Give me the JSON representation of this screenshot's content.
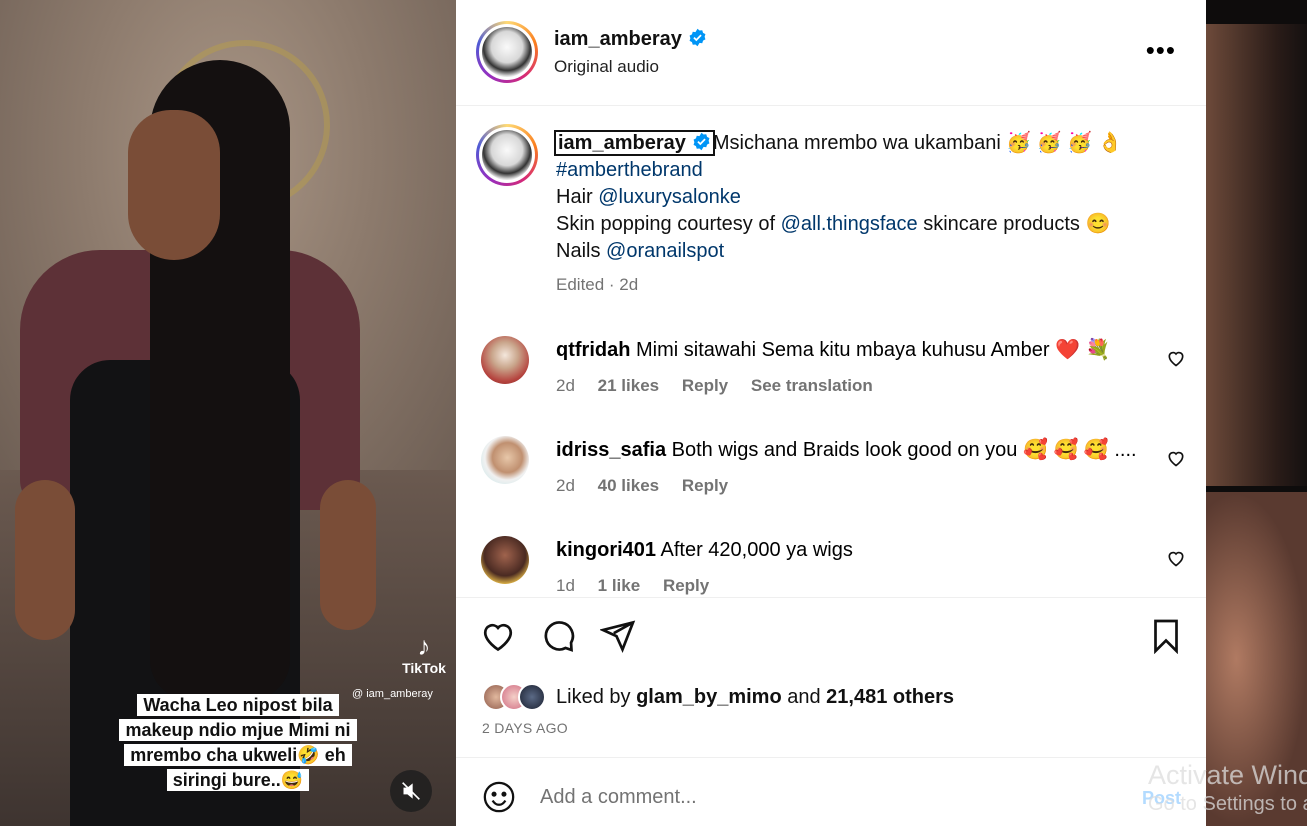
{
  "video": {
    "overlay_text": "Wacha Leo nipost bila makeup ndio mjue Mimi ni mrembo cha ukweli🤣 eh siringi bure..😅",
    "tiktok_label": "TikTok",
    "tiktok_handle": "@ iam_amberay"
  },
  "header": {
    "username": "iam_amberay",
    "subtitle": "Original audio",
    "more_label": "•••"
  },
  "caption": {
    "username": "iam_amberay",
    "line1": "Msichana mrembo wa ukambani 🥳 🥳 🥳 👌",
    "hashtag": "#amberthebrand",
    "hair_prefix": "Hair ",
    "hair_link": "@luxurysalonke",
    "skin_prefix": "Skin popping courtesy of ",
    "skin_link": "@all.thingsface",
    "skin_suffix": " skincare products 😊",
    "nails_prefix": "Nails ",
    "nails_link": "@oranailspot",
    "meta": "Edited · 2d"
  },
  "comments": [
    {
      "user": "qtfridah",
      "text": "Mimi sitawahi Sema kitu mbaya kuhusu Amber ❤️ 💐",
      "time": "2d",
      "likes": "21 likes",
      "reply": "Reply",
      "translate": "See translation"
    },
    {
      "user": "idriss_safia",
      "text": "Both wigs and Braids look good on you 🥰 🥰 🥰 ....",
      "time": "2d",
      "likes": "40 likes",
      "reply": "Reply",
      "translate": ""
    },
    {
      "user": "kingori401",
      "text": "After 420,000 ya wigs",
      "time": "1d",
      "likes": "1 like",
      "reply": "Reply",
      "translate": ""
    }
  ],
  "likes": {
    "prefix": "Liked by ",
    "user": "glam_by_mimo",
    "middle": " and ",
    "count": "21,481 others"
  },
  "posted": "2 DAYS AGO",
  "add_comment": {
    "placeholder": "Add a comment...",
    "post_label": "Post"
  },
  "watermark": {
    "line1": "Activate Windows",
    "line2": "Go to Settings to activate Windows."
  },
  "colors": {
    "link": "#00376b",
    "verified": "#0095f6",
    "muted": "#737373"
  }
}
